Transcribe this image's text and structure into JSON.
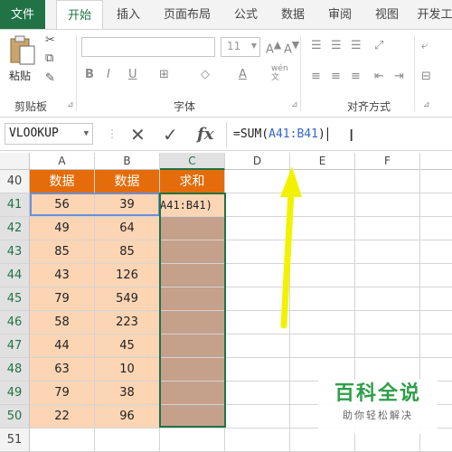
{
  "ribbon_tabs": [
    "文件",
    "开始",
    "插入",
    "页面布局",
    "公式",
    "数据",
    "审阅",
    "视图",
    "开发工"
  ],
  "ribbon": {
    "paste_label": "粘贴",
    "clipboard_label": "剪贴板",
    "font_label": "字体",
    "alignment_label": "对齐方式",
    "font_size": "11",
    "wen_label": "wén\n文"
  },
  "formula_bar": {
    "name_box": "VLOOKUP",
    "formula_prefix": "=SUM(",
    "formula_ref": "A41:B41",
    "formula_suffix": ")",
    "fx_label": "fx"
  },
  "columns": [
    "A",
    "B",
    "C",
    "D",
    "E",
    "F"
  ],
  "rows": [
    {
      "num": "40",
      "a": "数据",
      "b": "数据",
      "c": "求和"
    },
    {
      "num": "41",
      "a": "56",
      "b": "39",
      "c": "A41:B41)"
    },
    {
      "num": "42",
      "a": "49",
      "b": "64",
      "c": ""
    },
    {
      "num": "43",
      "a": "85",
      "b": "85",
      "c": ""
    },
    {
      "num": "44",
      "a": "43",
      "b": "126",
      "c": ""
    },
    {
      "num": "45",
      "a": "79",
      "b": "549",
      "c": ""
    },
    {
      "num": "46",
      "a": "58",
      "b": "223",
      "c": ""
    },
    {
      "num": "47",
      "a": "44",
      "b": "45",
      "c": ""
    },
    {
      "num": "48",
      "a": "63",
      "b": "10",
      "c": ""
    },
    {
      "num": "49",
      "a": "79",
      "b": "38",
      "c": ""
    },
    {
      "num": "50",
      "a": "22",
      "b": "96",
      "c": ""
    },
    {
      "num": "51",
      "a": "",
      "b": "",
      "c": ""
    }
  ],
  "watermark": {
    "title": "百科全说",
    "subtitle": "助你轻松解决"
  },
  "colors": {
    "header_fill": "#e46c0a",
    "data_fill": "#fcd5b4",
    "selected_fill": "#c5a08a",
    "excel_green": "#217346",
    "arrow": "#f2f200"
  }
}
